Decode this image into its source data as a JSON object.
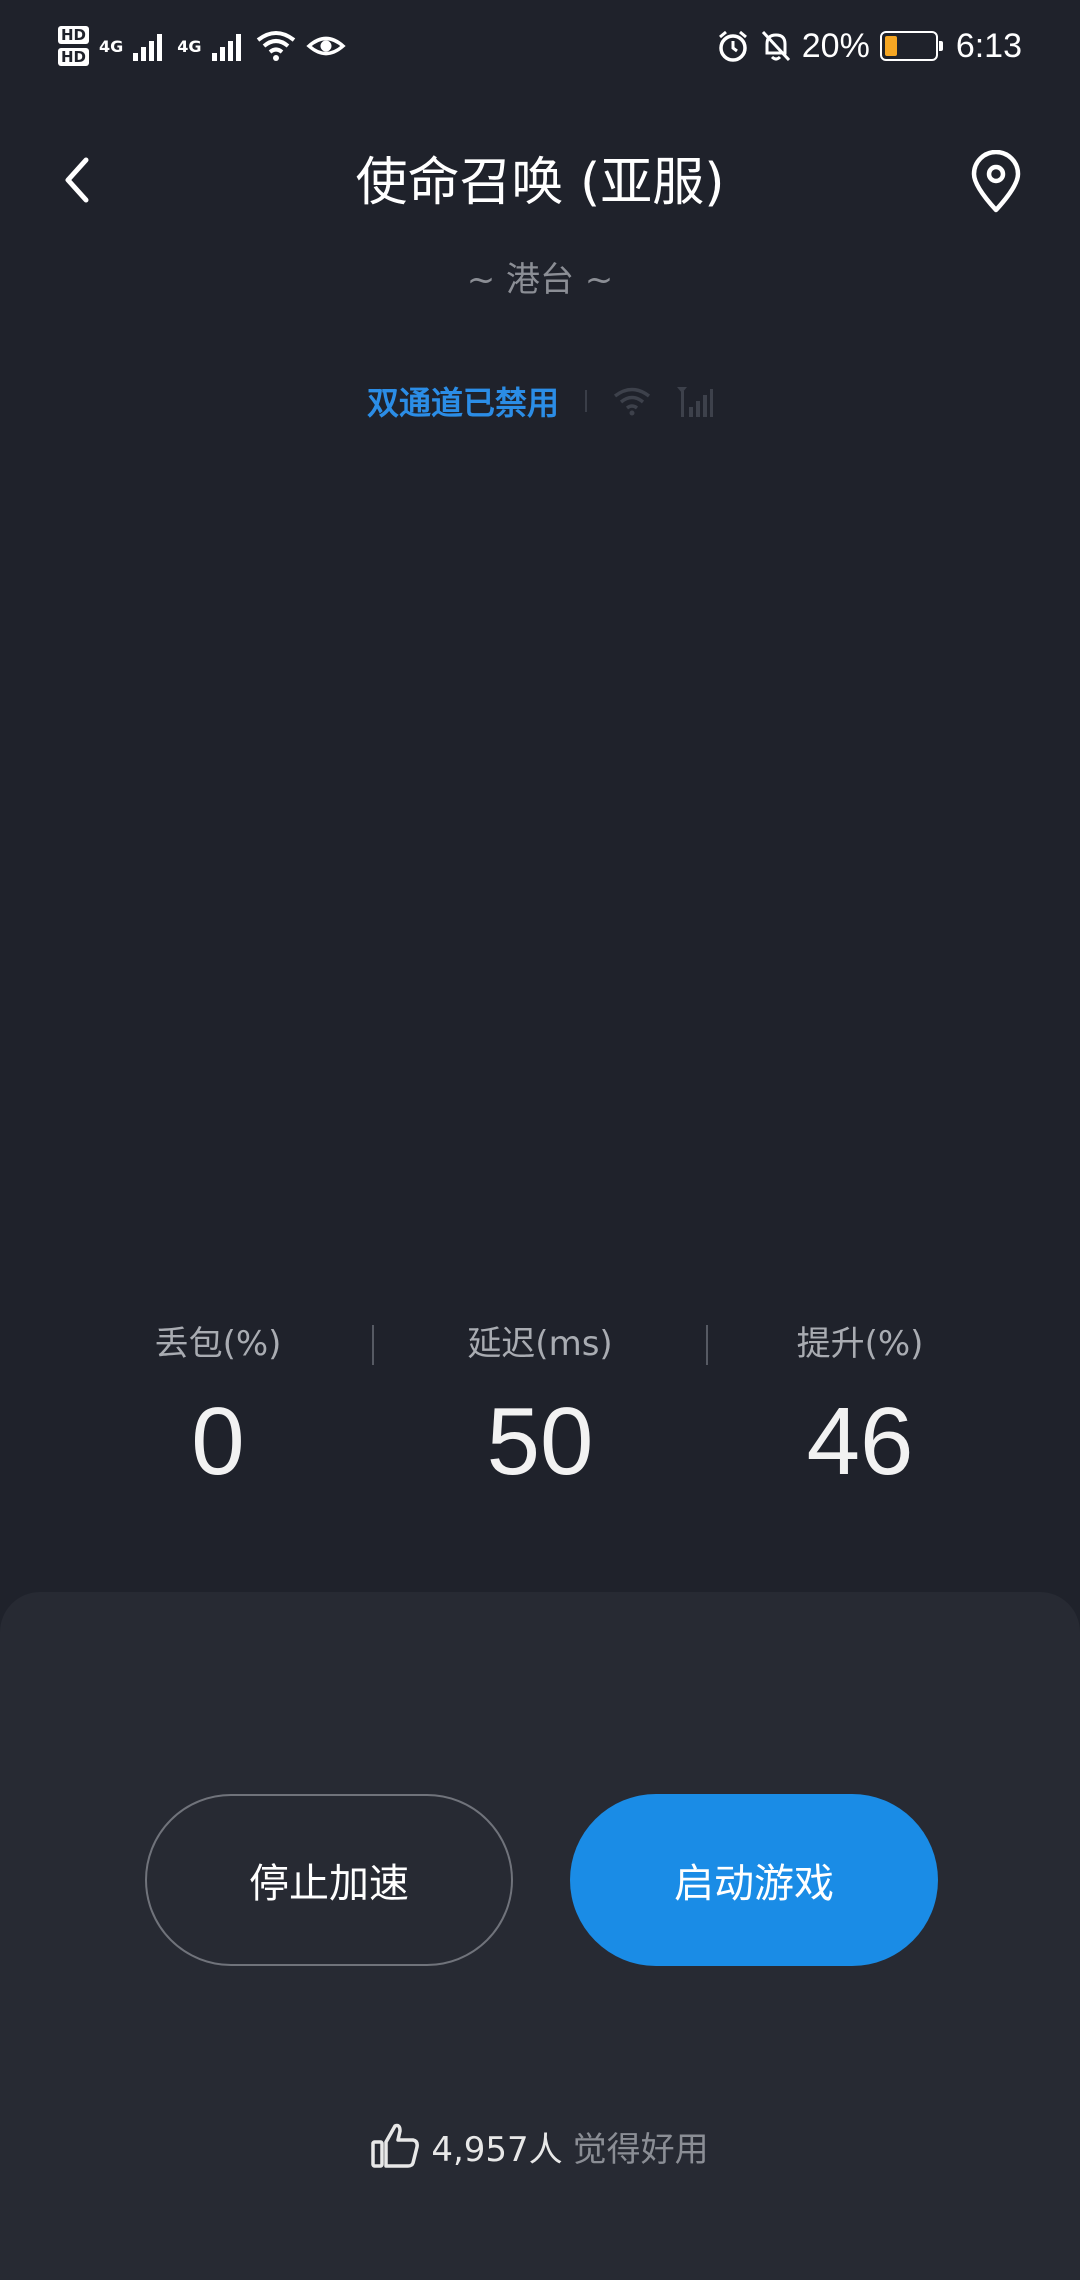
{
  "status_bar": {
    "hd1": "HD",
    "hd2": "HD",
    "net1": "4G",
    "net2": "4G",
    "battery": "20%",
    "time": "6:13",
    "icons": [
      "signal-icon",
      "wifi-icon",
      "eye-icon",
      "alarm-icon",
      "mute-icon",
      "battery-icon"
    ]
  },
  "header": {
    "title": "使命召唤 (亚服)",
    "region": "~ 港台 ~",
    "back_icon": "back-arrow-icon",
    "location_icon": "location-pin-icon"
  },
  "channel": {
    "status": "双通道已禁用",
    "icons": [
      "wifi-icon",
      "cellular-icon"
    ]
  },
  "stats": [
    {
      "label": "丢包(%)",
      "value": "0"
    },
    {
      "label": "延迟(ms)",
      "value": "50"
    },
    {
      "label": "提升(%)",
      "value": "46"
    }
  ],
  "actions": {
    "stop_label": "停止加速",
    "start_label": "启动游戏"
  },
  "likes": {
    "count": "4,957人",
    "text": "觉得好用",
    "icon": "thumbs-up-icon"
  },
  "colors": {
    "background": "#1f222b",
    "panel": "#272a33",
    "accent": "#1a8ce6",
    "channel_text": "#2b8de6"
  }
}
